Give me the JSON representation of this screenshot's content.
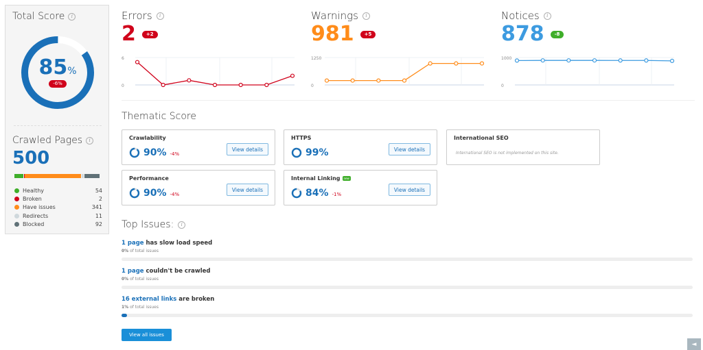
{
  "total_score": {
    "title": "Total Score",
    "value": "85",
    "unit": "%",
    "delta": "-6%",
    "fraction": 0.85
  },
  "crawled_pages": {
    "title": "Crawled Pages",
    "value": "500",
    "items": [
      {
        "label": "Healthy",
        "count": "54",
        "color": "#3fae2a"
      },
      {
        "label": "Broken",
        "count": "2",
        "color": "#d0021b"
      },
      {
        "label": "Have issues",
        "count": "341",
        "color": "#ff8c1a"
      },
      {
        "label": "Redirects",
        "count": "11",
        "color": "#cfd8dc"
      },
      {
        "label": "Blocked",
        "count": "92",
        "color": "#607177"
      }
    ]
  },
  "metrics": [
    {
      "title": "Errors",
      "value": "2",
      "delta": "+2",
      "delta_type": "red",
      "color": "#d0021b",
      "ymax_label": "6",
      "ymin_label": "0",
      "ymax": 6,
      "points": [
        5,
        0,
        1,
        0,
        0,
        0,
        2
      ]
    },
    {
      "title": "Warnings",
      "value": "981",
      "delta": "+5",
      "delta_type": "red",
      "color": "#ff8c1a",
      "ymax_label": "1250",
      "ymin_label": "0",
      "ymax": 1250,
      "points": [
        200,
        200,
        200,
        200,
        980,
        980,
        981
      ]
    },
    {
      "title": "Notices",
      "value": "878",
      "delta": "-8",
      "delta_type": "green",
      "color": "#3d9be0",
      "ymax_label": "1000",
      "ymin_label": "0",
      "ymax": 1000,
      "points": [
        890,
        895,
        895,
        895,
        893,
        893,
        878
      ]
    }
  ],
  "thematic": {
    "title": "Thematic Score",
    "cards": [
      {
        "name": "Crawlability",
        "pct": "90%",
        "delta": "-4%",
        "button": "View details",
        "fraction": 0.9
      },
      {
        "name": "HTTPS",
        "pct": "99%",
        "delta": "",
        "button": "View details",
        "fraction": 0.99
      },
      {
        "name": "International SEO",
        "note": "International SEO is not implemented on this site."
      },
      {
        "name": "Performance",
        "pct": "90%",
        "delta": "-4%",
        "button": "View details",
        "fraction": 0.9
      },
      {
        "name": "Internal Linking",
        "badge": "new",
        "pct": "84%",
        "delta": "-1%",
        "button": "View details",
        "fraction": 0.84
      }
    ]
  },
  "top_issues": {
    "title": "Top Issues:",
    "items": [
      {
        "link": "1 page",
        "text": " has slow load speed",
        "pct": "0%",
        "sub": " of total issues",
        "fraction": 0.0
      },
      {
        "link": "1 page",
        "text": " couldn't be crawled",
        "pct": "0%",
        "sub": " of total issues",
        "fraction": 0.0
      },
      {
        "link": "16 external links",
        "text": " are broken",
        "pct": "1%",
        "sub": " of total issues",
        "fraction": 0.01
      }
    ],
    "button": "View all issues"
  }
}
